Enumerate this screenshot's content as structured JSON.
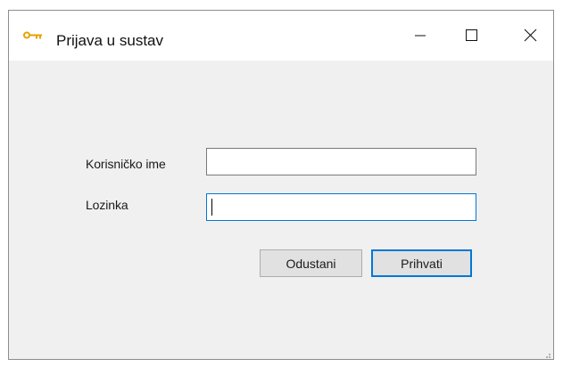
{
  "window": {
    "title": "Prijava u sustav",
    "icon": "key-icon",
    "controls": [
      "minimize-icon",
      "maximize-icon",
      "close-icon"
    ]
  },
  "form": {
    "username_label": "Korisničko ime",
    "username_value": "",
    "password_label": "Lozinka",
    "password_value": ""
  },
  "buttons": {
    "cancel_label": "Odustani",
    "accept_label": "Prihvati"
  },
  "colors": {
    "titlebar": "#ffffff",
    "client": "#f0f0f0",
    "focus_accent": "#0078d7",
    "key_icon": "#e8a100"
  }
}
